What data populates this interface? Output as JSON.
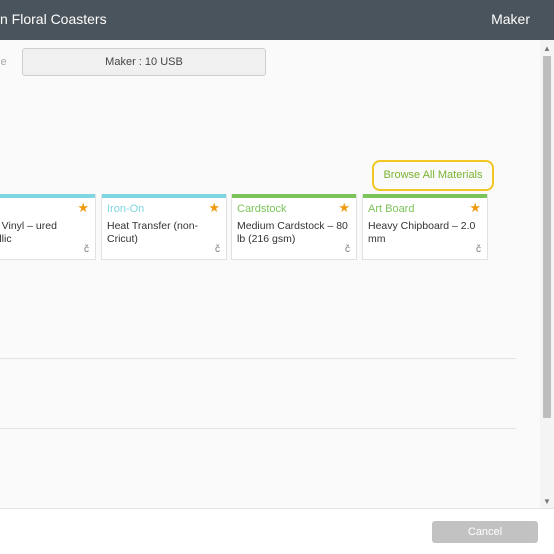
{
  "header": {
    "project_title": "n Floral Coasters",
    "machine": "Maker"
  },
  "machine_selector": {
    "label": "ine",
    "value": "Maker : 10 USB"
  },
  "browse_button": "Browse All Materials",
  "materials": [
    {
      "category": "",
      "name": "nium Vinyl – ured Metallic",
      "color": "#7fd6e0"
    },
    {
      "category": "Iron-On",
      "name": "Heat Transfer (non-Cricut)",
      "color": "#7fd6e0"
    },
    {
      "category": "Cardstock",
      "name": "Medium Cardstock – 80 lb (216 gsm)",
      "color": "#7cc35a"
    },
    {
      "category": "Art Board",
      "name": "Heavy Chipboard – 2.0 mm",
      "color": "#7cc35a"
    }
  ],
  "favorite_glyph": "★",
  "cricut_glyph": "č",
  "footer": {
    "cancel": "Cancel"
  }
}
